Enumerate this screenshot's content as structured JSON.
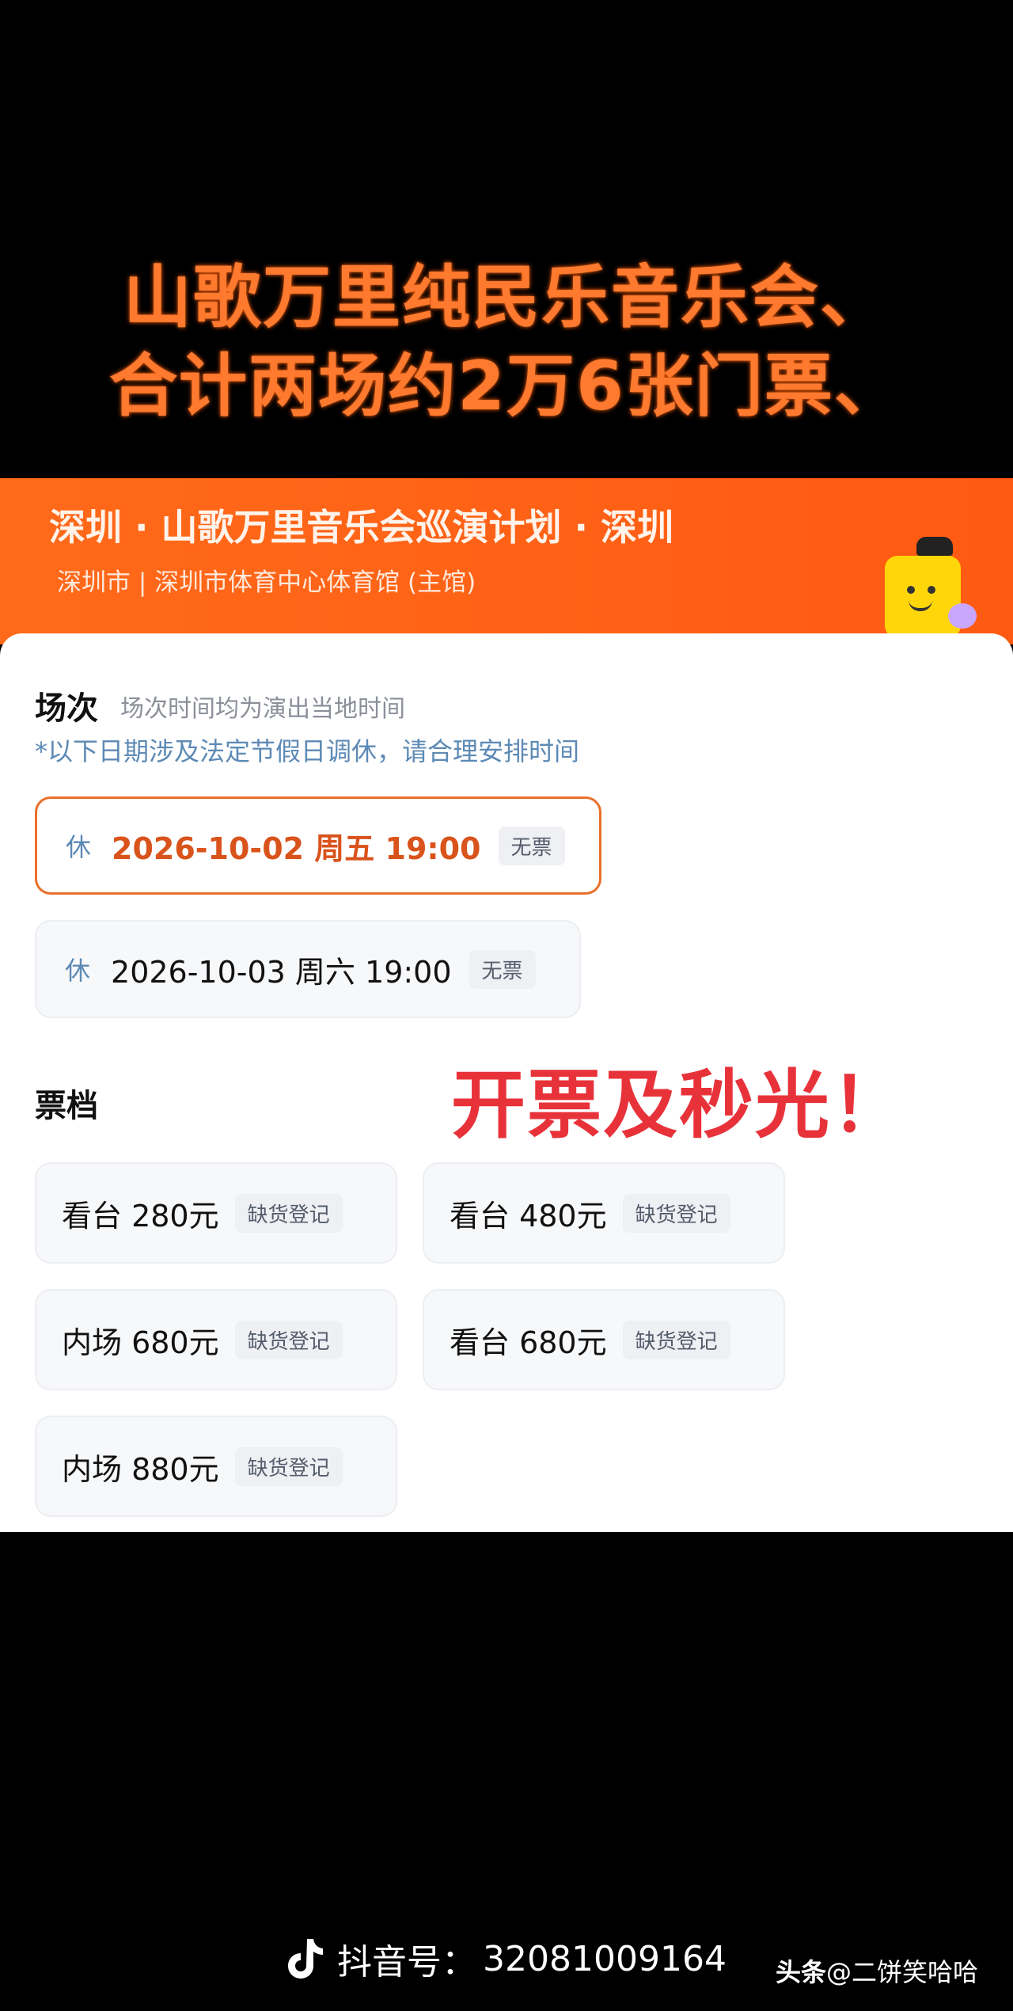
{
  "caption": {
    "line1": "山歌万里纯民乐音乐会、",
    "line2": "合计两场约2万6张门票、"
  },
  "event": {
    "title": "深圳 · 山歌万里音乐会巡演计划 · 深圳",
    "venue": "深圳市 | 深圳市体育中心体育馆 (主馆)"
  },
  "sessions_section": {
    "title": "场次",
    "subtitle": "场次时间均为演出当地时间",
    "note": "*以下日期涉及法定节假日调休，请合理安排时间",
    "items": [
      {
        "tag": "休",
        "datetime": "2026-10-02  周五 19:00",
        "badge": "无票",
        "selected": true
      },
      {
        "tag": "休",
        "datetime": "2026-10-03 周六 19:00",
        "badge": "无票",
        "selected": false
      }
    ]
  },
  "stamp_text": "开票及秒光！",
  "tiers_section": {
    "title": "票档",
    "items": [
      {
        "name": "看台 280元",
        "badge": "缺货登记"
      },
      {
        "name": "看台 480元",
        "badge": "缺货登记"
      },
      {
        "name": "内场 680元",
        "badge": "缺货登记"
      },
      {
        "name": "看台 680元",
        "badge": "缺货登记"
      },
      {
        "name": "内场 880元",
        "badge": "缺货登记"
      }
    ]
  },
  "footer": {
    "platform_icon": "tiktok-icon",
    "label": "抖音号：",
    "id": "32081009164",
    "watermark_brand": "头条",
    "watermark_user": "@二饼笑哈哈"
  },
  "colors": {
    "accent_orange": "#ff5a12",
    "selected_border": "#e8702a",
    "stamp_red": "#e8323a",
    "note_blue": "#5d8ab5"
  }
}
